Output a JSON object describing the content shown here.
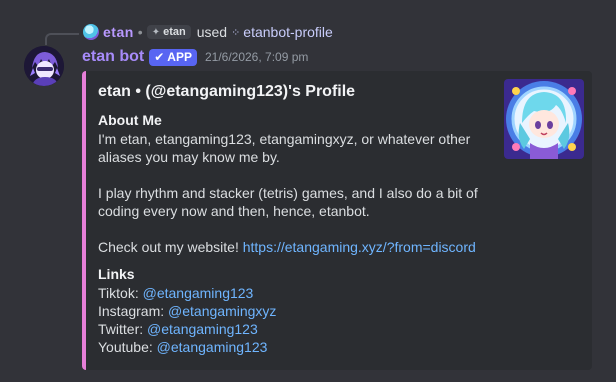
{
  "interaction": {
    "user_name": "etan",
    "separator": "•",
    "tag": "etan",
    "used_word": "used",
    "command": "etanbot-profile"
  },
  "message": {
    "username": "etan bot",
    "badge": "APP",
    "timestamp": "21/6/2026, 7:09 pm"
  },
  "embed": {
    "title": "etan • (@etangaming123)'s Profile",
    "accent_color": "#e67fd8",
    "about_heading": "About Me",
    "about_line1": "I'm etan, etangaming123, etangamingxyz, or whatever other",
    "about_line2": "aliases you may know me by.",
    "about_line3": "I play rhythm and stacker (tetris) games, and I also do a bit of",
    "about_line4": "coding every now and then, hence, etanbot.",
    "website_prefix": "Check out my website! ",
    "website_url": "https://etangaming.xyz/?from=discord",
    "links_heading": "Links",
    "links": [
      {
        "label": "Tiktok: ",
        "handle": "@etangaming123"
      },
      {
        "label": "Instagram: ",
        "handle": "@etangamingxyz"
      },
      {
        "label": "Twitter: ",
        "handle": "@etangaming123"
      },
      {
        "label": "Youtube: ",
        "handle": "@etangaming123"
      }
    ]
  }
}
